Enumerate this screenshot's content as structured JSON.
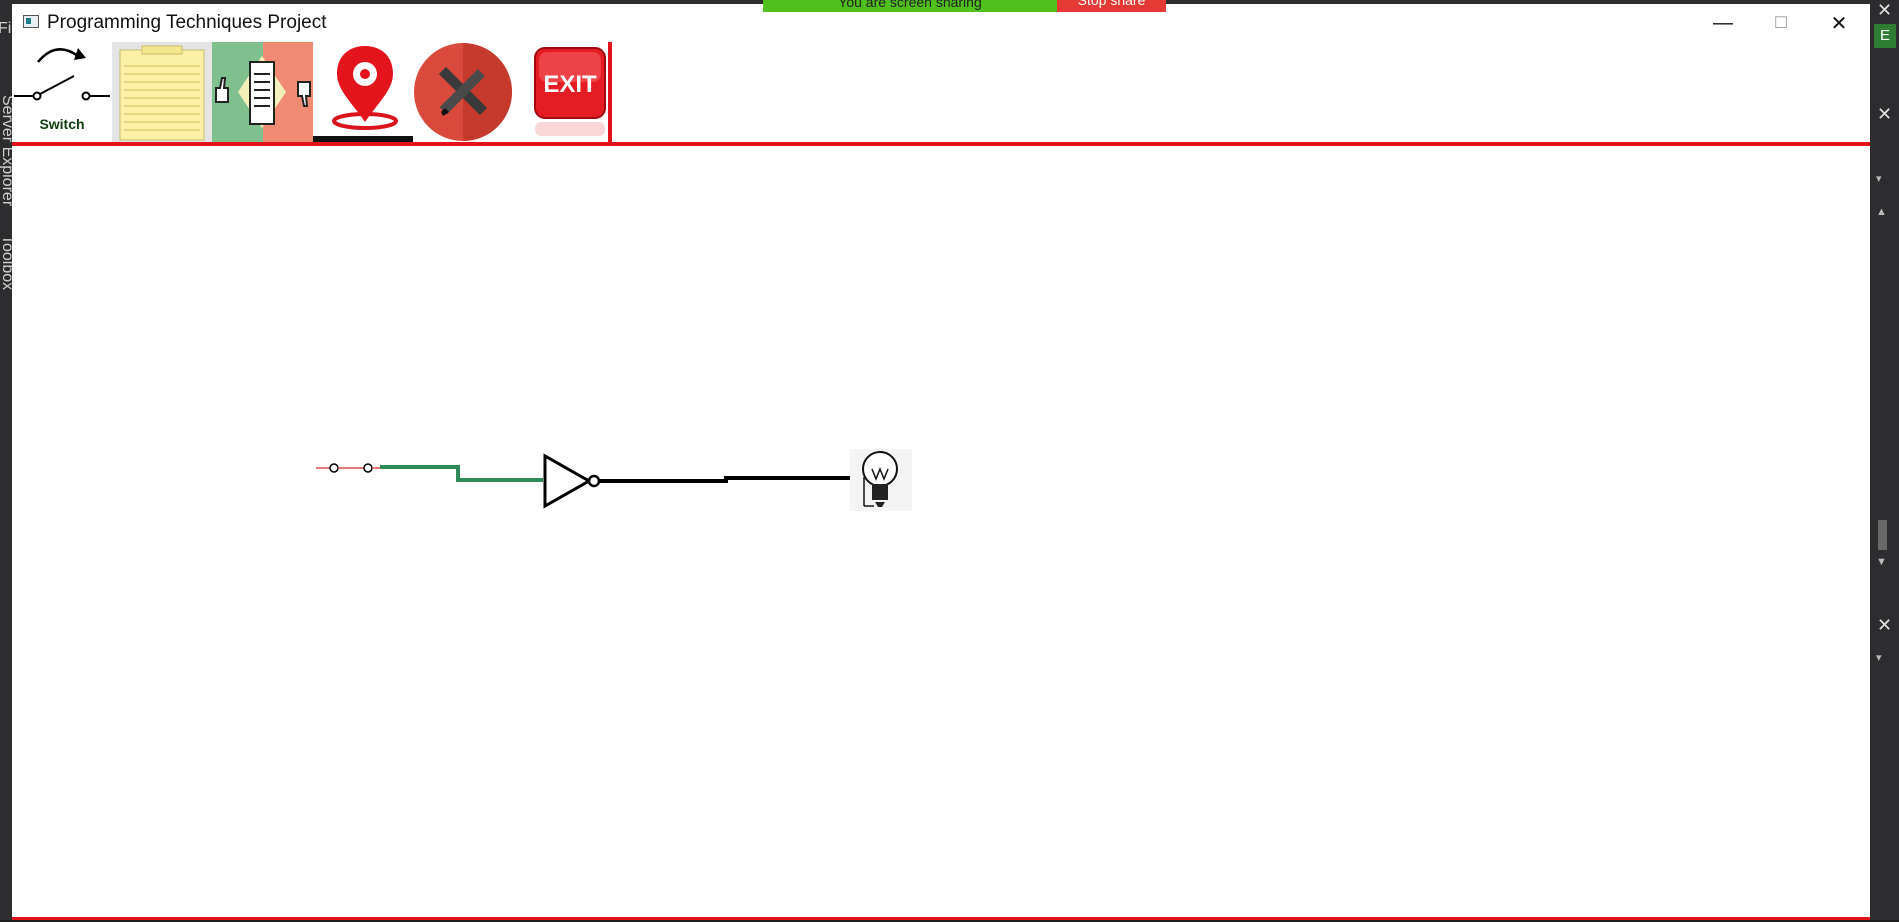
{
  "ide": {
    "left_label_top": "Fil",
    "side_tabs": [
      "Server Explorer",
      "Toolbox"
    ],
    "right_badge": "E"
  },
  "share_banner": {
    "message": "You are screen sharing",
    "stop_label": "Stop share"
  },
  "window": {
    "title": "Programming Techniques Project",
    "minimize_glyph": "—",
    "maximize_glyph": "☐",
    "close_glyph": "✕"
  },
  "toolbar": {
    "items": [
      {
        "name": "switch",
        "label": "Switch"
      },
      {
        "name": "notes"
      },
      {
        "name": "like-dislike"
      },
      {
        "name": "location-pin"
      },
      {
        "name": "edit"
      },
      {
        "name": "exit",
        "label": "EXIT"
      }
    ],
    "accent_color": "#e3121b"
  },
  "circuit": {
    "components": [
      "switch",
      "not-gate",
      "bulb"
    ],
    "wire_colors": {
      "active": "#2e8b57",
      "inactive": "#000000",
      "switch_lead": "#d9534f"
    }
  }
}
